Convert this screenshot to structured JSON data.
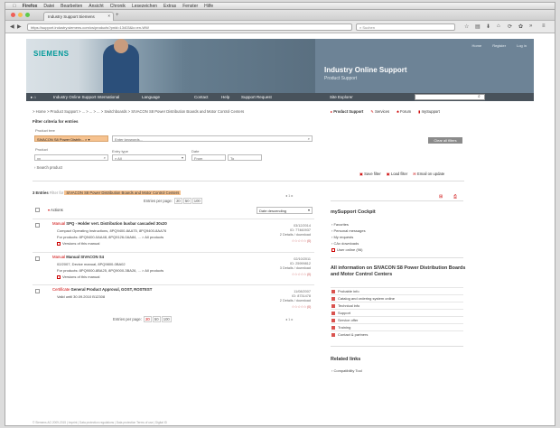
{
  "mac_menu": [
    "Firefox",
    "Datei",
    "Bearbeiten",
    "Ansicht",
    "Chronik",
    "Lesezeichen",
    "Extras",
    "Fenster",
    "Hilfe"
  ],
  "browser": {
    "tab_title": "Industry Support Siemens",
    "url": "https://support.industry.siemens.com/cs/products?pnid=13403&lc=en-WW",
    "search_placeholder": "Suchen"
  },
  "header": {
    "logo": "SIEMENS",
    "links": [
      "Home",
      "Register",
      "Log in"
    ],
    "title": "Industry Online Support",
    "subtitle": "Product Support"
  },
  "site_nav": {
    "items": [
      "Industry Online Support International",
      "Language",
      "Contact",
      "Help",
      "Support Request",
      "Site Explorer"
    ]
  },
  "breadcrumb": "> Home > Product Support > ... > ... > ... > Switchboards > SIVACON S8 Power Distribution Boards and Motor Control Centers",
  "top_links": [
    "Product Support",
    "Services",
    "Forum",
    "mySupport"
  ],
  "filter": {
    "title": "Filter criteria for entries",
    "product_tree_label": "Product tree",
    "product_tree_value": "SIVACON S8 Power Distrib... × ▾",
    "keywords_placeholder": "Enter keywords...",
    "clear_label": "Clear all filters",
    "product_label": "Product",
    "product_value": "xx",
    "entry_type_label": "Entry type",
    "entry_type_value": "All",
    "date_label": "Date",
    "date_from": "From",
    "date_to": "To",
    "search_product": "› Search product",
    "actions": [
      "Save filter",
      "Load filter",
      "Email on update"
    ]
  },
  "entries": {
    "count_label": "3 Entries",
    "filter_prefix": "Filter for",
    "filter_tag": "SIVACON S8 Power Distribution Boards and Motor Control Centers",
    "per_page_label": "Entries per page:",
    "per_page_options": [
      "20",
      "50",
      "100"
    ],
    "pager": "◂ 1 ▸",
    "actions_label": "Actions",
    "sort_value": "Date descending",
    "items": [
      {
        "type": "Manual",
        "title": "SPQ - Holder vert. Distribution busbar cascaded 30x20",
        "line1": "Compact Operating Instructions, 8PQ9400-8AA75, 8PQ9400-8AA76",
        "line2": "For products: 8PQ9400-0AA48, 8PQ9126-0AA84, ... > All products",
        "line3": "Versions of this manual",
        "date": "03/12/2014",
        "id": "ID: 77460937",
        "meta": "2 Details / download",
        "rating": "☆☆☆☆☆ (0)"
      },
      {
        "type": "Manual",
        "title": "Manual SIVACON S4",
        "line1": "02/2007, Device manual, 8PQ9800-0BA02",
        "line2": "For products: 8PQ9000-8BA25, 8PQ9000-3BA26, ... > All products",
        "line3": "Versions of this manual",
        "date": "02/10/2011",
        "id": "ID: 25999812",
        "meta": "3 Details / download",
        "rating": "☆☆☆☆☆ (0)"
      },
      {
        "type": "Certificate",
        "title": "General Product Approval, GOST, ROSTEST",
        "line1": "Valid until 30.09.2010 B12308",
        "line2": "",
        "line3": "",
        "date": "11/08/2007",
        "id": "ID: 8731478",
        "meta": "2 Details / download",
        "rating": "☆☆☆☆☆ (0)"
      }
    ]
  },
  "cockpit": {
    "title": "mySupport Cockpit",
    "links": [
      "Favorites",
      "Personal messages",
      "My requests",
      "CAx downloads"
    ],
    "user_online": "User online (96)"
  },
  "info": {
    "title": "All information on SIVACON S8 Power Distribution Boards and Motor Control Centers",
    "items": [
      "Probable info",
      "Catalog and ordering system online",
      "Technical info",
      "Support",
      "Service offer",
      "Training",
      "Contact & partners"
    ]
  },
  "related": {
    "title": "Related links",
    "items": [
      "Compatibility Tool"
    ]
  },
  "footer": "© Siemens AG 2009-2015 | Imprint | Data protection regulations | Data protection Terms of use | Digital ID"
}
